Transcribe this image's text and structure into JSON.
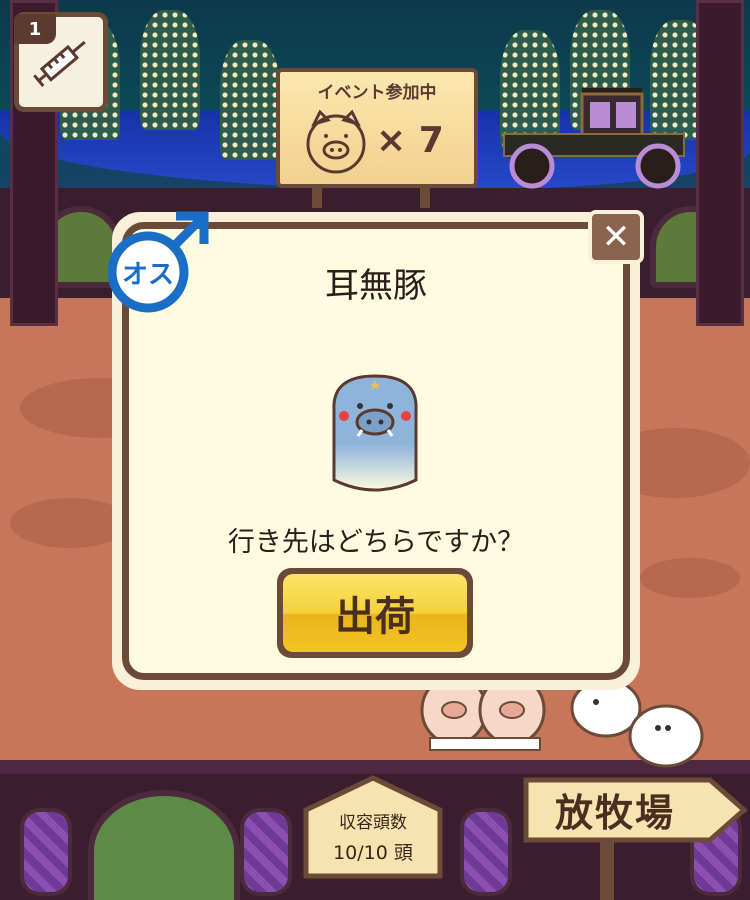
{
  "item_slot": {
    "count": "1",
    "icon": "syringe-icon"
  },
  "event_sign": {
    "title": "イベント参加中",
    "multiplier": "× 7",
    "icon": "pig-face-icon"
  },
  "dialog": {
    "gender_label": "オス",
    "gender_icon": "male-symbol-icon",
    "pig_name": "耳無豚",
    "question": "行き先はどちらですか？",
    "ship_button": "出荷",
    "close_glyph": "✕"
  },
  "capacity": {
    "label": "収容頭数",
    "value": "10/10 頭"
  },
  "ranch_sign": {
    "label": "放牧場"
  },
  "colors": {
    "wood": "#6b4a38",
    "dialog_bg": "#fefbe0",
    "button_yellow": "#f5d13a",
    "male_blue": "#1a6ec8",
    "ground": "#c8765a"
  }
}
